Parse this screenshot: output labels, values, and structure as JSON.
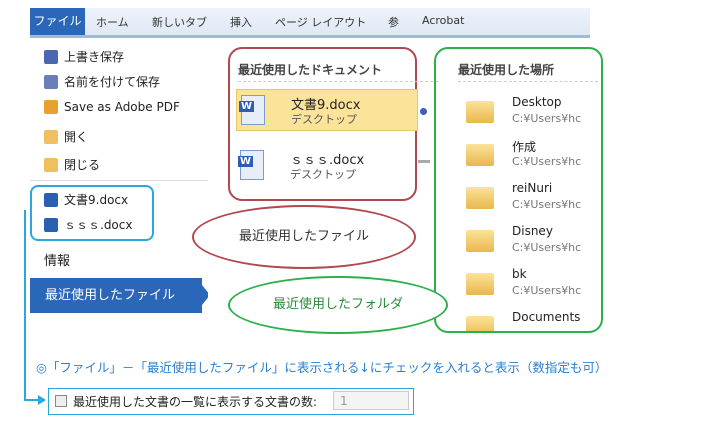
{
  "ribbon": {
    "tabs": [
      "ファイル",
      "ホーム",
      "新しいタブ",
      "挿入",
      "ページ レイアウト",
      "参",
      "Acrobat"
    ]
  },
  "menu": {
    "items": [
      "上書き保存",
      "名前を付けて保存",
      "Save as Adobe PDF",
      "開く",
      "閉じる"
    ],
    "recent": [
      "文書9.docx",
      "ｓｓｓ.docx"
    ],
    "info": "情報",
    "selected": "最近使用したファイル"
  },
  "docs": {
    "heading": "最近使用したドキュメント",
    "items": [
      {
        "name": "文書9.docx",
        "loc": "デスクトップ"
      },
      {
        "name": "ｓｓｓ.docx",
        "loc": "デスクトップ"
      }
    ]
  },
  "places": {
    "heading": "最近使用した場所",
    "items": [
      {
        "name": "Desktop",
        "path": "C:¥Users¥hc"
      },
      {
        "name": "作成",
        "path": "C:¥Users¥hc"
      },
      {
        "name": "reiNuri",
        "path": "C:¥Users¥hc"
      },
      {
        "name": "Disney",
        "path": "C:¥Users¥hc"
      },
      {
        "name": "bk",
        "path": "C:¥Users¥hc"
      },
      {
        "name": "Documents",
        "path": ""
      }
    ]
  },
  "callouts": {
    "files": "最近使用したファイル",
    "folders": "最近使用したフォルダ"
  },
  "note": "◎「ファイル」－「最近使用したファイル」に表示される↓にチェックを入れると表示（数指定も可）",
  "option": {
    "label": "最近使用した文書の一覧に表示する文書の数:",
    "value": "1"
  }
}
